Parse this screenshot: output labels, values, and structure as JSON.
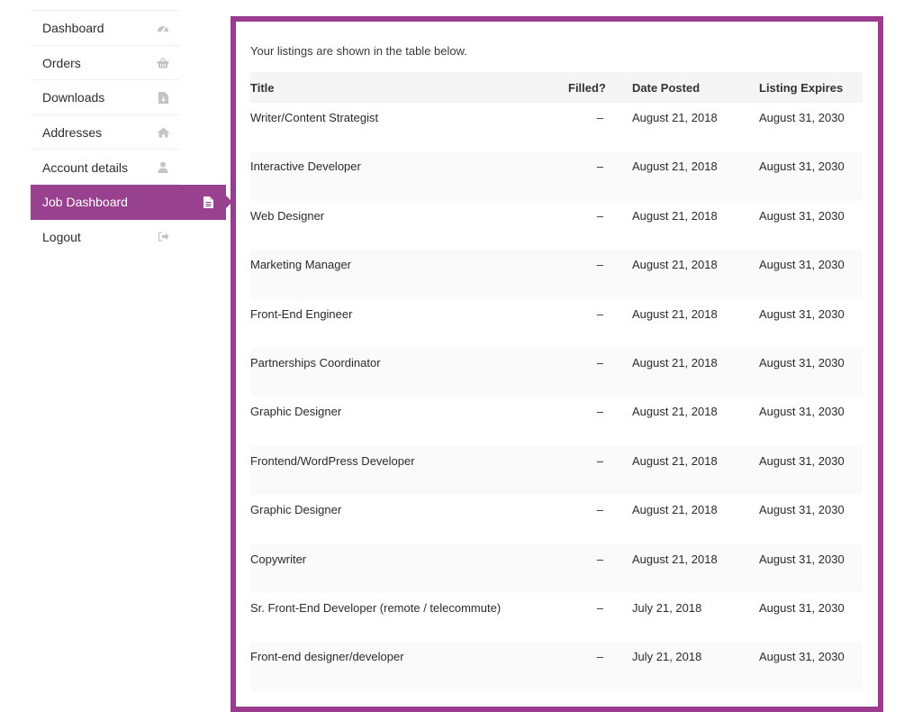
{
  "sidebar": {
    "items": [
      {
        "label": "Dashboard",
        "icon": "gauge-icon"
      },
      {
        "label": "Orders",
        "icon": "basket-icon"
      },
      {
        "label": "Downloads",
        "icon": "file-download-icon"
      },
      {
        "label": "Addresses",
        "icon": "home-icon"
      },
      {
        "label": "Account details",
        "icon": "user-icon"
      },
      {
        "label": "Job Dashboard",
        "icon": "document-icon",
        "active": true
      },
      {
        "label": "Logout",
        "icon": "sign-out-icon"
      }
    ]
  },
  "main": {
    "intro": "Your listings are shown in the table below.",
    "columns": {
      "title": "Title",
      "filled": "Filled?",
      "date_posted": "Date Posted",
      "expires": "Listing Expires"
    },
    "rows": [
      {
        "title": "Writer/Content Strategist",
        "filled": "–",
        "date_posted": "August 21, 2018",
        "expires": "August 31, 2030"
      },
      {
        "title": "Interactive Developer",
        "filled": "–",
        "date_posted": "August 21, 2018",
        "expires": "August 31, 2030"
      },
      {
        "title": "Web Designer",
        "filled": "–",
        "date_posted": "August 21, 2018",
        "expires": "August 31, 2030"
      },
      {
        "title": "Marketing Manager",
        "filled": "–",
        "date_posted": "August 21, 2018",
        "expires": "August 31, 2030"
      },
      {
        "title": "Front-End Engineer",
        "filled": "–",
        "date_posted": "August 21, 2018",
        "expires": "August 31, 2030"
      },
      {
        "title": "Partnerships Coordinator",
        "filled": "–",
        "date_posted": "August 21, 2018",
        "expires": "August 31, 2030"
      },
      {
        "title": "Graphic Designer",
        "filled": "–",
        "date_posted": "August 21, 2018",
        "expires": "August 31, 2030"
      },
      {
        "title": "Frontend/WordPress Developer",
        "filled": "–",
        "date_posted": "August 21, 2018",
        "expires": "August 31, 2030"
      },
      {
        "title": "Graphic Designer",
        "filled": "–",
        "date_posted": "August 21, 2018",
        "expires": "August 31, 2030"
      },
      {
        "title": "Copywriter",
        "filled": "–",
        "date_posted": "August 21, 2018",
        "expires": "August 31, 2030"
      },
      {
        "title": "Sr. Front-End Developer (remote / telecommute)",
        "filled": "–",
        "date_posted": "July 21, 2018",
        "expires": "August 31, 2030"
      },
      {
        "title": "Front-end designer/developer",
        "filled": "–",
        "date_posted": "July 21, 2018",
        "expires": "August 31, 2030"
      }
    ]
  },
  "colors": {
    "accent": "#97418f",
    "panel_border": "#9a3b8d"
  }
}
